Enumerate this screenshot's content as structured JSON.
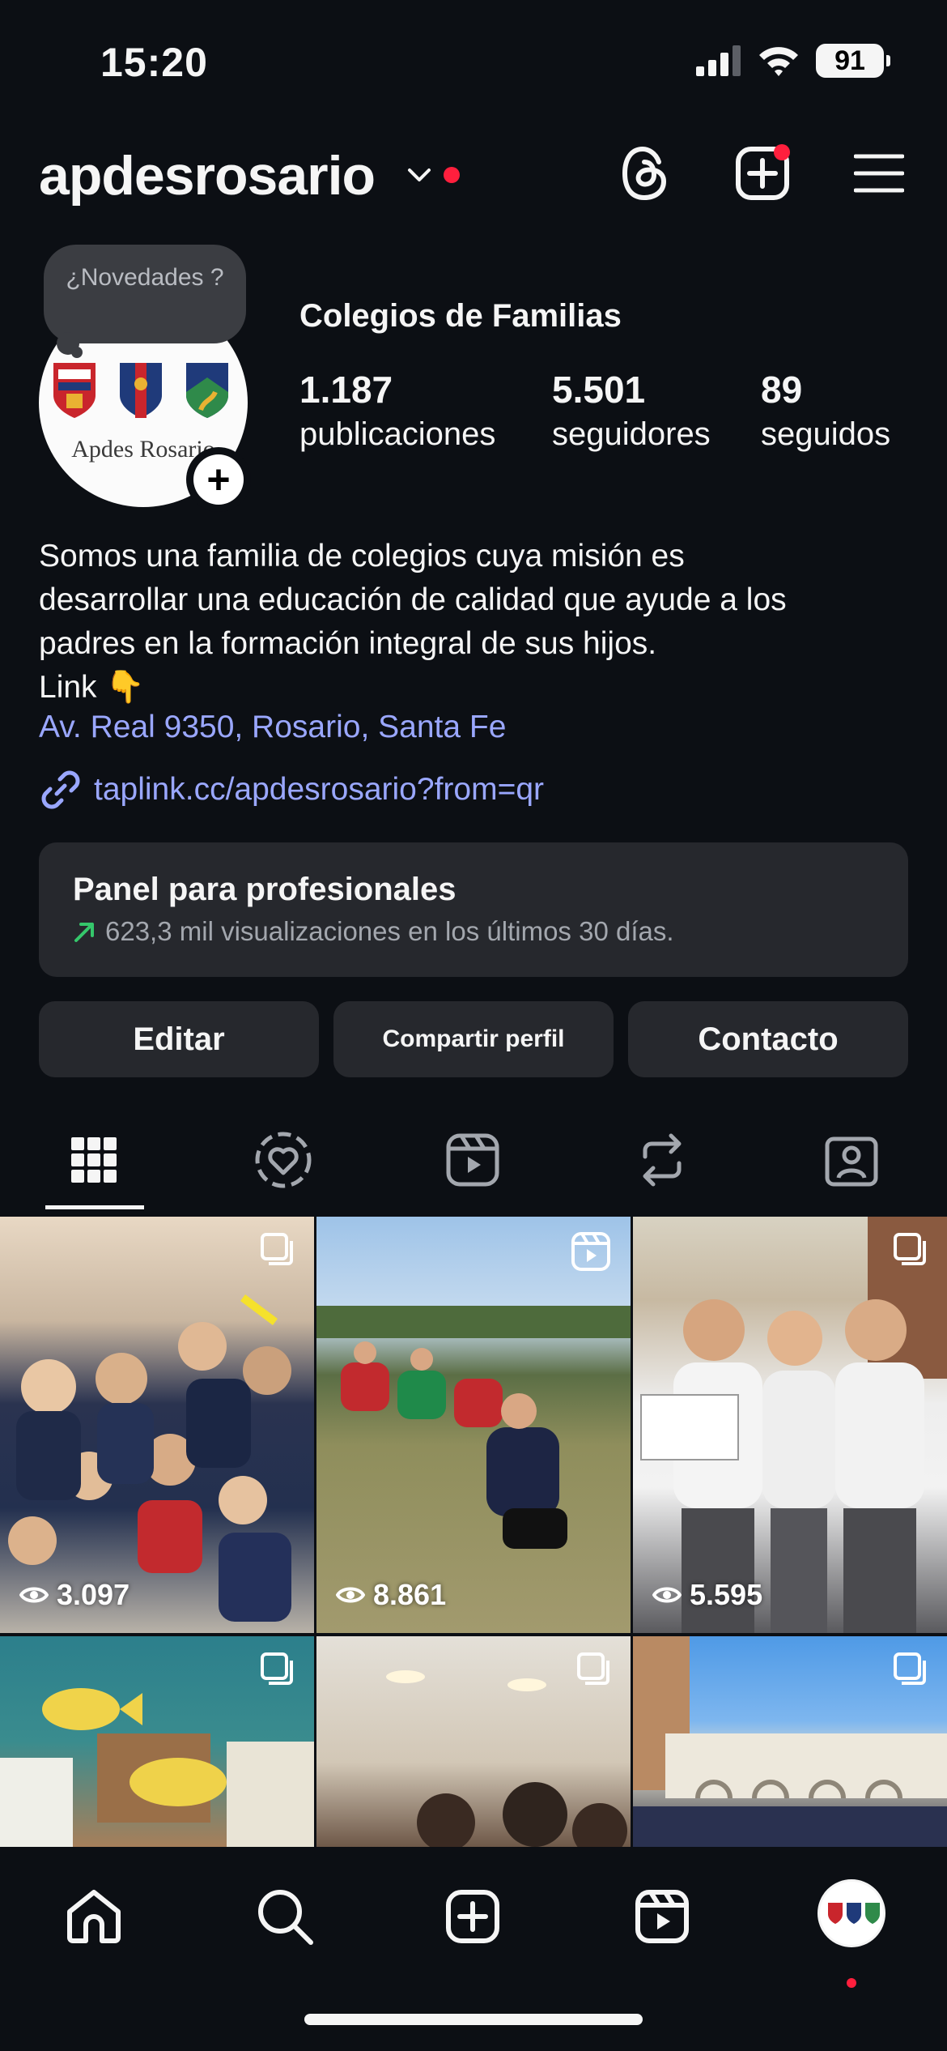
{
  "status_bar": {
    "time": "15:20",
    "battery": "91"
  },
  "header": {
    "username": "apdesrosario"
  },
  "profile": {
    "note": "¿Novedades ?",
    "avatar_text": "Apdes Rosario",
    "category": "Colegios de Familias",
    "stats": [
      {
        "value": "1.187",
        "label": "publicaciones"
      },
      {
        "value": "5.501",
        "label": "seguidores"
      },
      {
        "value": "89",
        "label": "seguidos"
      }
    ],
    "bio_line1": "Somos una familia de colegios cuya misión es",
    "bio_line2": "desarrollar una educación de calidad que ayude a los",
    "bio_line3": "padres en la formación integral de sus hijos.",
    "bio_line4": "Link 👇",
    "address": "Av. Real 9350, Rosario, Santa Fe",
    "link": "taplink.cc/apdesrosario?from=qr"
  },
  "panel": {
    "title": "Panel para profesionales",
    "subtitle": "623,3 mil visualizaciones en los últimos 30 días."
  },
  "buttons": {
    "edit": "Editar",
    "share": "Compartir perfil",
    "contact": "Contacto"
  },
  "grid": {
    "posts": [
      {
        "views": "3.097",
        "badge": "multi-photo-icon"
      },
      {
        "views": "8.861",
        "badge": "reel-icon"
      },
      {
        "views": "5.595",
        "badge": "multi-photo-icon"
      },
      {
        "views": "",
        "badge": "multi-photo-icon"
      },
      {
        "views": "",
        "badge": "multi-photo-icon"
      },
      {
        "views": "",
        "badge": "multi-photo-icon"
      }
    ]
  },
  "colors": {
    "background": "#0c0f14",
    "accent_link": "#9aa7ff",
    "notification": "#ff1f3d",
    "card": "#26282d"
  }
}
